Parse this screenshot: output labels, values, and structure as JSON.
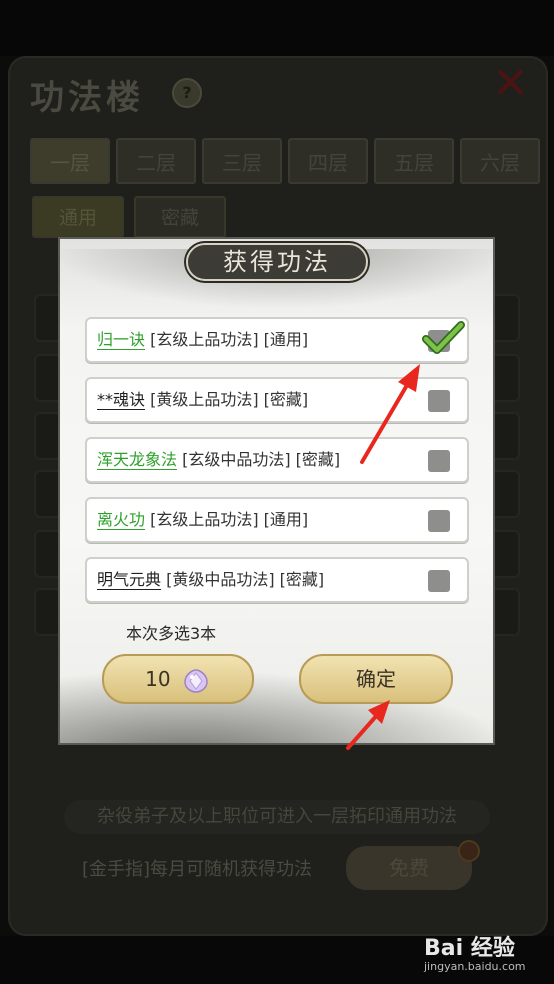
{
  "background": {
    "title": "功法楼",
    "help_symbol": "?",
    "close_symbol": "✕",
    "floor_tabs": [
      "一层",
      "二层",
      "三层",
      "四层",
      "五层",
      "六层"
    ],
    "sub_tabs": [
      "通用",
      "密藏"
    ],
    "notice": "杂役弟子及以上职位可进入一层拓印通用功法",
    "monthly_text": "[金手指]每月可随机获得功法",
    "free_button": "免费"
  },
  "modal": {
    "title": "获得功法",
    "items": [
      {
        "name": "归一诀",
        "name_color": "green",
        "tags": "[玄级上品功法] [通用]",
        "checked": true
      },
      {
        "name": "**魂诀",
        "name_color": "black",
        "tags": "[黄级上品功法] [密藏]",
        "checked": false
      },
      {
        "name": "浑天龙象法",
        "name_color": "green",
        "tags": "[玄级中品功法] [密藏]",
        "checked": false
      },
      {
        "name": "离火功",
        "name_color": "green",
        "tags": "[玄级上品功法] [通用]",
        "checked": false
      },
      {
        "name": "明气元典",
        "name_color": "black",
        "tags": "[黄级中品功法] [密藏]",
        "checked": false
      }
    ],
    "multi_select_note": "本次多选3本",
    "cost_button": {
      "amount": "10",
      "icon": "spirit-gem-icon"
    },
    "confirm_button": "确定"
  },
  "watermark": {
    "brand": "Bai 经验",
    "url": "jingyan.baidu.com"
  },
  "colors": {
    "green_name": "#2ea12a",
    "arrow": "#e8281e",
    "button_gold": "#d9c07c"
  }
}
